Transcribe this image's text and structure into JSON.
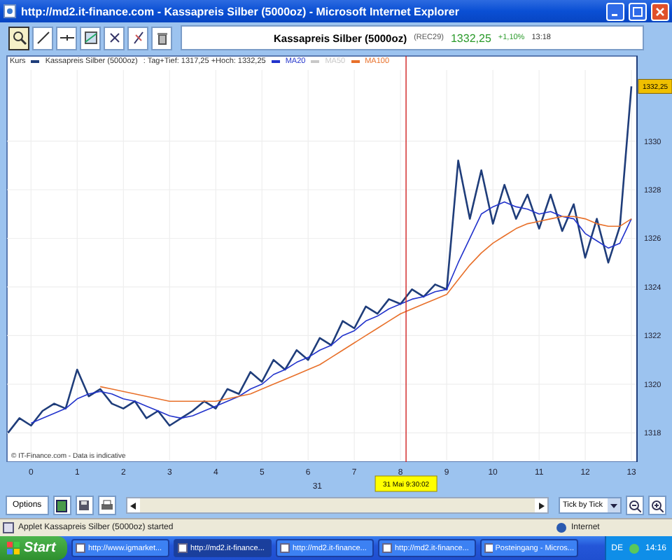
{
  "window": {
    "title": "http://md2.it-finance.com - Kassapreis Silber (5000oz) - Microsoft Internet Explorer"
  },
  "toolbar": {
    "tools": [
      {
        "kind": "zoom",
        "selected": true
      },
      {
        "kind": "line",
        "selected": false
      },
      {
        "kind": "hline",
        "selected": false
      },
      {
        "kind": "channel",
        "selected": false
      },
      {
        "kind": "cross",
        "selected": false
      },
      {
        "kind": "slash",
        "selected": false
      },
      {
        "kind": "trash",
        "selected": false
      }
    ]
  },
  "header": {
    "name": "Kassapreis Silber (5000oz)",
    "code": "(REC29)",
    "price": "1332,25",
    "change": "+1,10%",
    "time": "13:18"
  },
  "legend": {
    "label": "Kurs",
    "stats": ": Tag+Tief: 1317,25 +Hoch: 1332,25",
    "extra_items": [
      {
        "text": "MA50",
        "color": "#c8c8c8"
      }
    ]
  },
  "chart": {
    "price_tag": "1332,25",
    "date_label": "31",
    "cursor_label": "31 Mai 9:30:02",
    "copyright": "© IT-Finance.com - Data is indicative",
    "chart_data": {
      "type": "line",
      "grid": true,
      "legend": true,
      "xlim": [
        -0.52,
        13.12
      ],
      "ylim": [
        1316.8,
        1333.5
      ],
      "xticks": [
        0,
        1,
        2,
        3,
        4,
        5,
        6,
        7,
        8,
        9,
        10,
        11,
        12,
        13
      ],
      "yticks": [
        1318,
        1320,
        1322,
        1324,
        1326,
        1328,
        1330
      ],
      "x": [
        -0.5,
        -0.25,
        0,
        0.25,
        0.5,
        0.75,
        1,
        1.25,
        1.5,
        1.75,
        2,
        2.25,
        2.5,
        2.75,
        3,
        3.25,
        3.5,
        3.75,
        4,
        4.25,
        4.5,
        4.75,
        5,
        5.25,
        5.5,
        5.75,
        6,
        6.25,
        6.5,
        6.75,
        7,
        7.25,
        7.5,
        7.75,
        8,
        8.25,
        8.5,
        8.75,
        9,
        9.25,
        9.5,
        9.75,
        10,
        10.25,
        10.5,
        10.75,
        11,
        11.25,
        11.5,
        11.75,
        12,
        12.25,
        12.5,
        12.75,
        13
      ],
      "series": [
        {
          "name": "Kassapreis Silber (5000oz)",
          "color": "#1f3d7a",
          "values": [
            1318.0,
            1318.6,
            1318.3,
            1318.9,
            1319.2,
            1319.0,
            1320.6,
            1319.5,
            1319.8,
            1319.2,
            1319.0,
            1319.3,
            1318.6,
            1318.9,
            1318.3,
            1318.6,
            1318.9,
            1319.3,
            1319.0,
            1319.8,
            1319.6,
            1320.5,
            1320.1,
            1321.0,
            1320.6,
            1321.4,
            1321.0,
            1321.9,
            1321.6,
            1322.6,
            1322.3,
            1323.2,
            1322.9,
            1323.5,
            1323.3,
            1323.9,
            1323.6,
            1324.1,
            1323.9,
            1329.2,
            1326.8,
            1328.8,
            1326.6,
            1328.2,
            1326.8,
            1327.8,
            1326.4,
            1327.8,
            1326.3,
            1327.4,
            1325.2,
            1326.8,
            1325.0,
            1326.5,
            1332.25
          ]
        },
        {
          "name": "MA20",
          "color": "#2233cc",
          "values": [
            null,
            null,
            1318.4,
            1318.6,
            1318.8,
            1319.0,
            1319.4,
            1319.6,
            1319.7,
            1319.6,
            1319.4,
            1319.3,
            1319.1,
            1318.9,
            1318.7,
            1318.6,
            1318.7,
            1318.9,
            1319.1,
            1319.3,
            1319.5,
            1319.8,
            1320.0,
            1320.4,
            1320.6,
            1320.9,
            1321.1,
            1321.4,
            1321.6,
            1322.0,
            1322.2,
            1322.6,
            1322.8,
            1323.1,
            1323.3,
            1323.5,
            1323.6,
            1323.8,
            1323.9,
            1325.0,
            1326.0,
            1327.0,
            1327.3,
            1327.5,
            1327.3,
            1327.2,
            1327.0,
            1327.1,
            1326.9,
            1326.8,
            1326.2,
            1325.9,
            1325.6,
            1325.8,
            1326.8
          ]
        },
        {
          "name": "MA100",
          "color": "#e8702a",
          "values": [
            null,
            null,
            null,
            null,
            null,
            null,
            null,
            null,
            1319.9,
            1319.8,
            1319.7,
            1319.6,
            1319.5,
            1319.4,
            1319.3,
            1319.3,
            1319.3,
            1319.3,
            1319.3,
            1319.4,
            1319.5,
            1319.6,
            1319.8,
            1320.0,
            1320.2,
            1320.4,
            1320.6,
            1320.8,
            1321.1,
            1321.4,
            1321.7,
            1322.0,
            1322.3,
            1322.6,
            1322.9,
            1323.1,
            1323.3,
            1323.5,
            1323.7,
            1324.3,
            1324.9,
            1325.4,
            1325.8,
            1326.1,
            1326.4,
            1326.6,
            1326.7,
            1326.8,
            1326.9,
            1326.9,
            1326.8,
            1326.6,
            1326.5,
            1326.5,
            1326.8
          ]
        }
      ],
      "ref_lines": [
        {
          "axis": "x",
          "value": 8.12,
          "color": "#d02020"
        }
      ]
    }
  },
  "bottom_toolbar": {
    "options_button": "Options",
    "period": "Tick by Tick"
  },
  "status_bar": {
    "text": "Applet Kassapreis Silber (5000oz) started",
    "zone": "Internet"
  },
  "taskbar": {
    "start": "Start",
    "tasks": [
      {
        "label": "http://www.igmarket...",
        "selected": false
      },
      {
        "label": "http://md2.it-finance...",
        "selected": true
      },
      {
        "label": "http://md2.it-finance...",
        "selected": false
      },
      {
        "label": "http://md2.it-finance...",
        "selected": false
      },
      {
        "label": "Posteingang - Micros...",
        "selected": false
      }
    ],
    "language": "DE",
    "clock": "14:16"
  }
}
